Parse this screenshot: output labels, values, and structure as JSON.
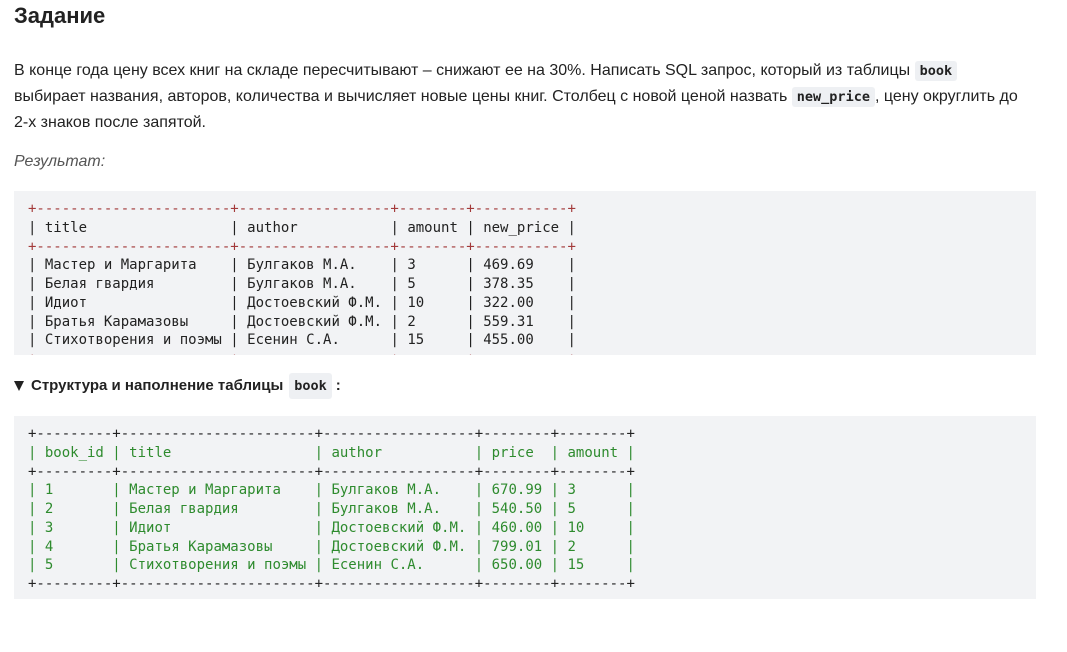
{
  "heading": "Задание",
  "description": {
    "part1": "В конце года цену всех книг на складе пересчитывают – снижают ее на 30%. Написать SQL запрос, который из таблицы ",
    "table_name": "book",
    "part2": " выбирает названия, авторов, количества и вычисляет новые цены книг. Столбец с новой ценой назвать ",
    "column_name": "new_price",
    "part3": ", цену округлить до 2-х знаков после запятой."
  },
  "result_label": "Результат:",
  "result_table": {
    "columns": [
      "title",
      "author",
      "amount",
      "new_price"
    ],
    "rows": [
      [
        "Мастер и Маргарита",
        "Булгаков М.А.",
        "3",
        "469.69"
      ],
      [
        "Белая гвардия",
        "Булгаков М.А.",
        "5",
        "378.35"
      ],
      [
        "Идиот",
        "Достоевский Ф.М.",
        "10",
        "322.00"
      ],
      [
        "Братья Карамазовы",
        "Достоевский Ф.М.",
        "2",
        "559.31"
      ],
      [
        "Стихотворения и поэмы",
        "Есенин С.А.",
        "15",
        "455.00"
      ]
    ]
  },
  "details": {
    "summary_text": "Структура и наполнение таблицы",
    "table_name": "book",
    "suffix": ":"
  },
  "source_table": {
    "columns": [
      "book_id",
      "title",
      "author",
      "price",
      "amount"
    ],
    "rows": [
      [
        "1",
        "Мастер и Маргарита",
        "Булгаков М.А.",
        "670.99",
        "3"
      ],
      [
        "2",
        "Белая гвардия",
        "Булгаков М.А.",
        "540.50",
        "5"
      ],
      [
        "3",
        "Идиот",
        "Достоевский Ф.М.",
        "460.00",
        "10"
      ],
      [
        "4",
        "Братья Карамазовы",
        "Достоевский Ф.М.",
        "799.01",
        "2"
      ],
      [
        "5",
        "Стихотворения и поэмы",
        "Есенин С.А.",
        "650.00",
        "15"
      ]
    ]
  },
  "colors": {
    "result_border": "#a33a3a",
    "source_text": "#2e8b2e",
    "code_background": "#f2f3f5"
  }
}
